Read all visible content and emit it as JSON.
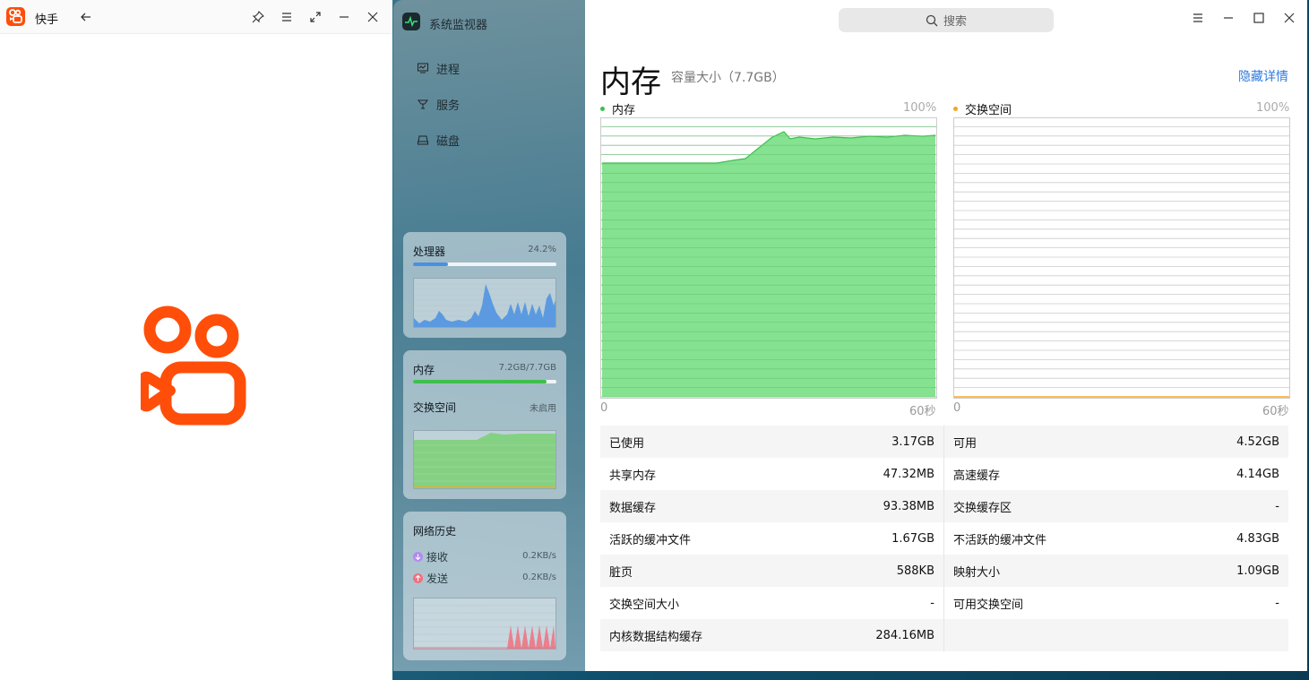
{
  "kuaishou": {
    "title": "快手"
  },
  "monitor": {
    "app_title": "系统监视器",
    "nav": [
      {
        "label": "进程"
      },
      {
        "label": "服务"
      },
      {
        "label": "磁盘"
      }
    ],
    "cpu_card": {
      "title": "处理器",
      "value": "24.2%",
      "usage": 0.242
    },
    "mem_card": {
      "title": "内存",
      "value": "7.2GB/7.7GB",
      "usage": 0.93,
      "swap_title": "交换空间",
      "swap_value": "未启用"
    },
    "net_card": {
      "title": "网络历史",
      "recv_label": "接收",
      "recv_value": "0.2KB/s",
      "send_label": "发送",
      "send_value": "0.2KB/s"
    },
    "search_placeholder": "搜索",
    "page_title": "内存",
    "page_subtitle": "容量大小（7.7GB）",
    "hide_details": "隐藏详情",
    "mem_chart": {
      "label": "内存",
      "max": "100%",
      "x_start": "0",
      "x_end": "60秒"
    },
    "swap_chart": {
      "label": "交换空间",
      "max": "100%",
      "x_start": "0",
      "x_end": "60秒"
    },
    "stats": [
      {
        "l_label": "已使用",
        "l_value": "3.17GB",
        "r_label": "可用",
        "r_value": "4.52GB"
      },
      {
        "l_label": "共享内存",
        "l_value": "47.32MB",
        "r_label": "高速缓存",
        "r_value": "4.14GB"
      },
      {
        "l_label": "数据缓存",
        "l_value": "93.38MB",
        "r_label": "交换缓存区",
        "r_value": "-"
      },
      {
        "l_label": "活跃的缓冲文件",
        "l_value": "1.67GB",
        "r_label": "不活跃的缓冲文件",
        "r_value": "4.83GB"
      },
      {
        "l_label": "脏页",
        "l_value": "588KB",
        "r_label": "映射大小",
        "r_value": "1.09GB"
      },
      {
        "l_label": "交换空间大小",
        "l_value": "-",
        "r_label": "可用交换空间",
        "r_value": "-"
      },
      {
        "l_label": "内核数据结构缓存",
        "l_value": "284.16MB",
        "r_label": "",
        "r_value": ""
      }
    ],
    "colors": {
      "mem_green": "#7ee08a",
      "mem_green_line": "#3fbf4f",
      "swap_orange": "#f5a623",
      "cpu_blue": "#4a90e2",
      "send_red": "#f07080",
      "recv_purple": "#b38af0",
      "link_blue": "#2f7bde"
    }
  }
}
